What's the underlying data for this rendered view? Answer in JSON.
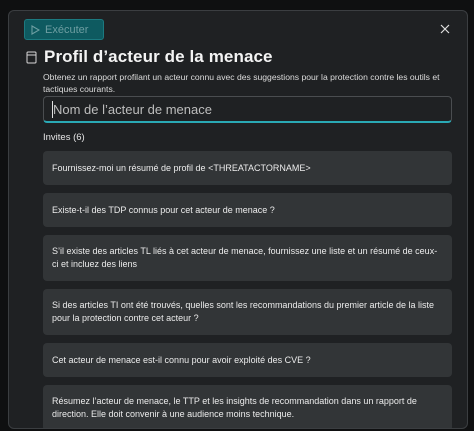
{
  "toolbar": {
    "run_label": "Exécuter",
    "run_icon": "play-icon",
    "close_icon": "close-icon"
  },
  "header": {
    "icon": "document-icon",
    "title": "Profil d’acteur de la menace",
    "subtitle": "Obtenez un rapport profilant un acteur connu avec des suggestions pour la protection contre les outils et tactiques courants."
  },
  "actor_input": {
    "value": "",
    "placeholder": "Nom de l’acteur de menace"
  },
  "prompts": {
    "label": "Invites (6)",
    "items": [
      "Fournissez-moi un résumé de profil de <THREATACTORNAME>",
      "Existe-t-il des TDP connus pour cet acteur de menace ?",
      "S’il existe des articles TL liés à cet acteur de menace, fournissez une liste et un résumé de ceux-ci et incluez des liens",
      "Si des articles TI ont été trouvés, quelles sont les recommandations du premier article de la liste pour la protection contre cet acteur ?",
      "Cet acteur de menace est-il connu pour avoir exploité des CVE ?",
      "Résumez l’acteur de menace, le TTP et les insights de recommandation dans un rapport de direction. Elle doit convenir à une audience moins technique."
    ]
  },
  "colors": {
    "background": "#1f2123",
    "card": "#323537",
    "accent": "#2aa9b5",
    "run_button": "#0e5a60"
  }
}
